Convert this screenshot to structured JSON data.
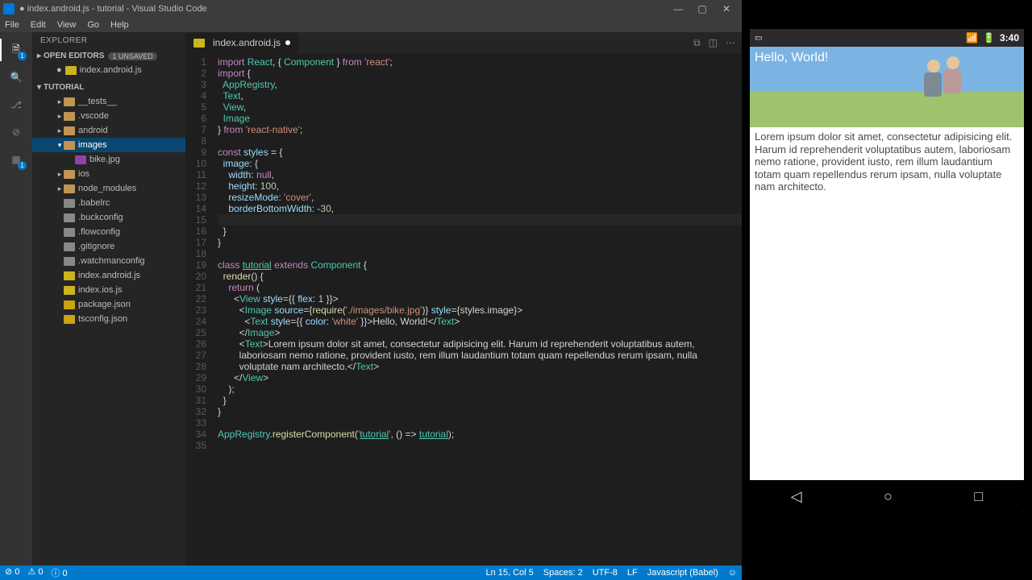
{
  "titlebar": "● index.android.js - tutorial - Visual Studio Code",
  "menu": [
    "File",
    "Edit",
    "View",
    "Go",
    "Help"
  ],
  "explorer": {
    "title": "EXPLORER",
    "open_editors": "OPEN EDITORS",
    "unsaved": "1 UNSAVED",
    "open_file": "index.android.js",
    "project": "TUTORIAL",
    "tree": [
      {
        "l": "__tests__",
        "t": "folder",
        "i": 1
      },
      {
        "l": ".vscode",
        "t": "folder",
        "i": 1
      },
      {
        "l": "android",
        "t": "folder",
        "i": 1
      },
      {
        "l": "images",
        "t": "folder",
        "i": 1,
        "open": true,
        "sel": true
      },
      {
        "l": "bike.jpg",
        "t": "img",
        "i": 2
      },
      {
        "l": "ios",
        "t": "folder",
        "i": 1
      },
      {
        "l": "node_modules",
        "t": "folder",
        "i": 1
      },
      {
        "l": ".babelrc",
        "t": "txt",
        "i": 1
      },
      {
        "l": ".buckconfig",
        "t": "txt",
        "i": 1
      },
      {
        "l": ".flowconfig",
        "t": "txt",
        "i": 1
      },
      {
        "l": ".gitignore",
        "t": "txt",
        "i": 1
      },
      {
        "l": ".watchmanconfig",
        "t": "txt",
        "i": 1
      },
      {
        "l": "index.android.js",
        "t": "js",
        "i": 1
      },
      {
        "l": "index.ios.js",
        "t": "js",
        "i": 1
      },
      {
        "l": "package.json",
        "t": "json",
        "i": 1
      },
      {
        "l": "tsconfig.json",
        "t": "json",
        "i": 1
      }
    ]
  },
  "tab": {
    "label": "index.android.js",
    "dirty": true
  },
  "code_lines": [
    "import React, { Component } from 'react';",
    "import {",
    "  AppRegistry,",
    "  Text,",
    "  View,",
    "  Image",
    "} from 'react-native';",
    "",
    "const styles = {",
    "  image: {",
    "    width: null,",
    "    height: 100,",
    "    resizeMode: 'cover',",
    "    borderBottomWidth: -30,",
    "    ",
    "  }",
    "}",
    "",
    "class tutorial extends Component {",
    "  render() {",
    "    return (",
    "      <View style={{ flex: 1 }}>",
    "        <Image source={require('./images/bike.jpg')} style={styles.image}>",
    "          <Text style={{ color: 'white' }}>Hello, World!</Text>",
    "        </Image>",
    "        <Text>Lorem ipsum dolor sit amet, consectetur adipisicing elit. Harum id reprehenderit voluptatibus autem,",
    "        laboriosam nemo ratione, provident iusto, rem illum laudantium totam quam repellendus rerum ipsam, nulla",
    "        voluptate nam architecto.</Text>",
    "      </View>",
    "    );",
    "  }",
    "}",
    "",
    "AppRegistry.registerComponent('tutorial', () => tutorial);",
    ""
  ],
  "cursor_line": 15,
  "status": {
    "errors": "0",
    "warnings": "0",
    "extras": "0",
    "pos": "Ln 15, Col 5",
    "spaces": "Spaces: 2",
    "enc": "UTF-8",
    "eol": "LF",
    "lang": "Javascript (Babel)"
  },
  "emulator": {
    "time": "3:40",
    "hello": "Hello, World!",
    "lorem": "Lorem ipsum dolor sit amet, consectetur adipisicing elit. Harum id reprehenderit voluptatibus autem, laboriosam nemo ratione, provident iusto, rem illum laudantium totam quam repellendus rerum ipsam, nulla voluptate nam architecto."
  }
}
